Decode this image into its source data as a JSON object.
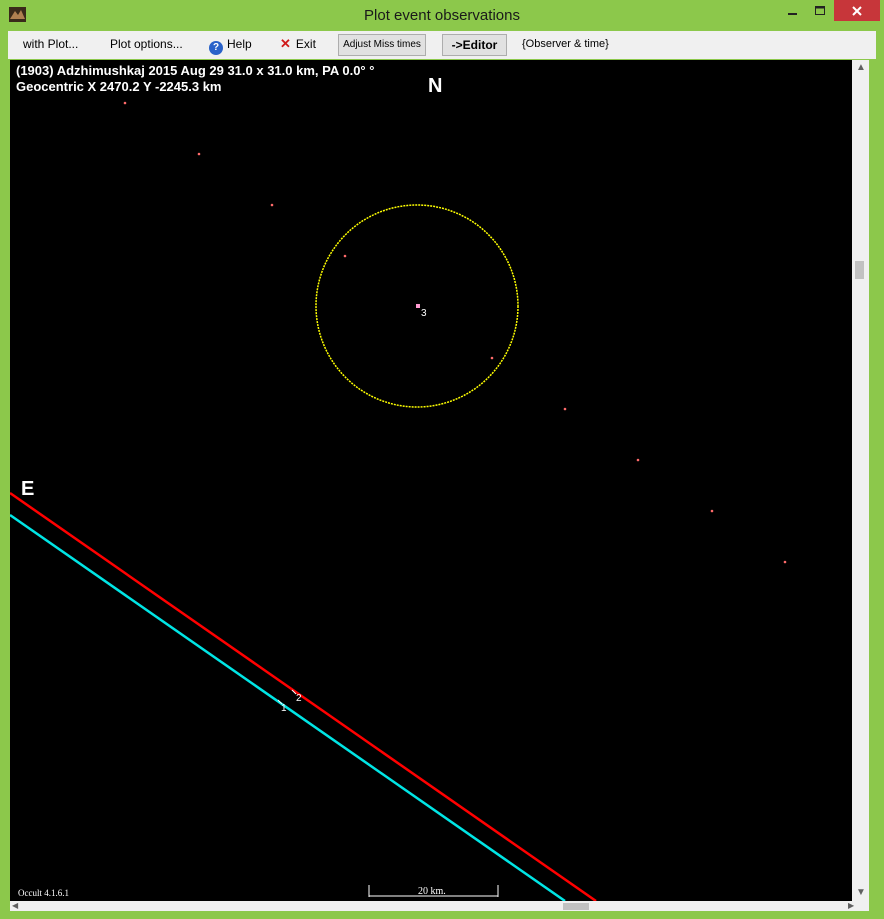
{
  "window": {
    "title": "Plot event observations",
    "title_color": "#8cc84b"
  },
  "toolbar": {
    "with_plot": "with Plot...",
    "plot_options": "Plot options...",
    "help": "Help",
    "exit": "Exit",
    "adjust_miss_times": "Adjust Miss times",
    "editor": "->Editor",
    "observer_time": "{Observer & time}"
  },
  "plot": {
    "header_line1": "(1903) Adzhimushkaj  2015 Aug 29   31.0 x 31.0 km, PA 0.0° °",
    "header_line2": "Geocentric  X  2470.2  Y  -2245.3 km",
    "north_label": "N",
    "east_label": "E",
    "version": "Occult 4.1.6.1",
    "scale_label": "20 km.",
    "background_color": "#000000",
    "ellipse_color": "#ffff00",
    "chord_colors": [
      "#ff0000",
      "#00e5e5"
    ],
    "observer_labels": [
      "1",
      "2",
      "3"
    ],
    "miss_marker_color": "#ff6b6b"
  }
}
